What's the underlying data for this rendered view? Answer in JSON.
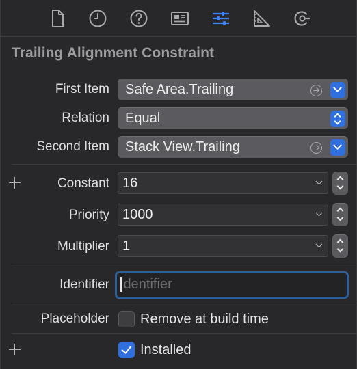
{
  "toolbar": {
    "tabs": [
      {
        "icon": "file-icon"
      },
      {
        "icon": "clock-icon"
      },
      {
        "icon": "question-icon"
      },
      {
        "icon": "identity-card-icon"
      },
      {
        "icon": "sliders-icon",
        "active": true
      },
      {
        "icon": "ruler-icon"
      },
      {
        "icon": "connections-icon"
      }
    ]
  },
  "title": "Trailing Alignment Constraint",
  "first_item": {
    "label": "First Item",
    "value": "Safe Area.Trailing"
  },
  "relation": {
    "label": "Relation",
    "value": "Equal"
  },
  "second_item": {
    "label": "Second Item",
    "value": "Stack View.Trailing"
  },
  "constant": {
    "label": "Constant",
    "value": "16"
  },
  "priority": {
    "label": "Priority",
    "value": "1000"
  },
  "multiplier": {
    "label": "Multiplier",
    "value": "1"
  },
  "identifier": {
    "label": "Identifier",
    "value": "",
    "placeholder": "Identifier"
  },
  "placeholder_opt": {
    "label": "Placeholder",
    "checkbox_label": "Remove at build time",
    "checked": false
  },
  "installed": {
    "label": "Installed",
    "checked": true
  },
  "colors": {
    "accent": "#2f6fde",
    "active_tab": "#3b82f6",
    "background": "#28282b"
  }
}
